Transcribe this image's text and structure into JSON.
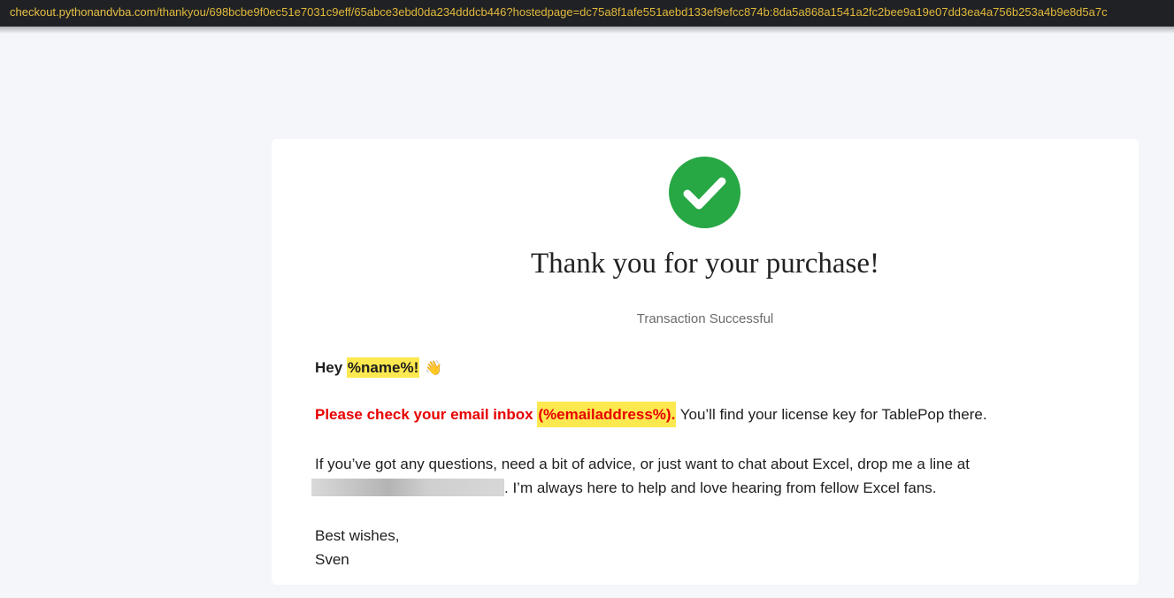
{
  "browser": {
    "url_host": "checkout.pythonandvba.com",
    "url_path": "/thankyou/698bcbe9f0ec51e7031c9eff/65abce3ebd0da234dddcb446?hostedpage=dc75a8f1afe551aebd133ef9efcc874b:8da5a868a1541a2fc2bee9a19e07dd3ea4a756b253a4b9e8d5a7c"
  },
  "page": {
    "title": "Thank you for your purchase!",
    "subtitle": "Transaction Successful",
    "greeting_prefix": "Hey ",
    "greeting_name": "%name%!",
    "greeting_emoji": "👋",
    "inbox_notice": "Please check your email inbox ",
    "inbox_email": "(%emailaddress%).",
    "license_text": " You’ll find your license key for TablePop there.",
    "questions_line1": "If you’ve got any questions, need a bit of advice, or just want to chat about Excel, drop me a line at",
    "questions_line2": ". I’m always here to help and love hearing from fellow Excel fans.",
    "closing": "Best wishes,",
    "signature": "Sven"
  },
  "colors": {
    "success": "#28a745",
    "alert_red": "#e80000",
    "highlight": "#fce94f"
  },
  "icons": {
    "success": "check-circle-icon"
  }
}
